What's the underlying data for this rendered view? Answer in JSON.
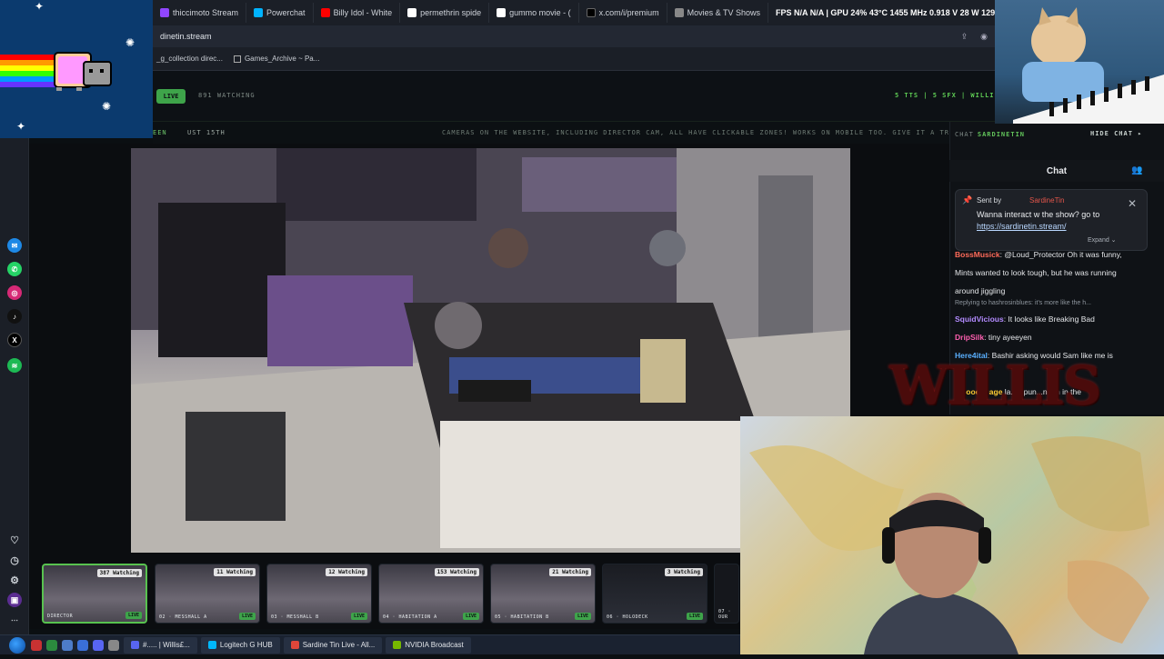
{
  "browser": {
    "tabs": [
      {
        "label": "thiccimoto Stream",
        "color": "#9146ff"
      },
      {
        "label": "Powerchat",
        "color": "#00b3ff"
      },
      {
        "label": "Billy Idol - White",
        "color": "#ff0000"
      },
      {
        "label": "permethrin spide",
        "color": "#ffffff"
      },
      {
        "label": "gummo movie - (",
        "color": "#ffffff"
      },
      {
        "label": "x.com/i/premium",
        "color": "#000000"
      },
      {
        "label": "Movies & TV Shows",
        "color": "#888888"
      },
      {
        "label": "FPS N/A N/A | GPU 24% 43°C 1455 MHz 0.918 V 28 W 1299 RPM",
        "color": "#1b1f27"
      }
    ],
    "address": "dinetin.stream",
    "bookmarks": [
      "_g_collection direc...",
      "Games_Archive ~ Pa..."
    ]
  },
  "site": {
    "live_label": "LIVE",
    "watching_label": "891 WATCHING",
    "tts_info": "5 TTS | 5 SFX | WILLISEXP",
    "ticker_left": "EEN",
    "ticker_date": "UST 15TH",
    "ticker_message": "CAMERAS ON THE WEBSITE, INCLUDING DIRECTOR CAM, ALL HAVE CLICKABLE ZONES! WORKS ON MOBILE TOO. GIVE IT A TRY!"
  },
  "thumbnails": [
    {
      "watching": "387 Watching",
      "label": "DIRECTOR",
      "live": "LIVE",
      "active": true
    },
    {
      "watching": "11 Watching",
      "label": "02 · MESSHALL A",
      "live": "LIVE",
      "active": false
    },
    {
      "watching": "12 Watching",
      "label": "03 · MESSHALL B",
      "live": "LIVE",
      "active": false
    },
    {
      "watching": "153 Watching",
      "label": "04 · HABITATION A",
      "live": "LIVE",
      "active": false
    },
    {
      "watching": "21 Watching",
      "label": "05 · HABITATION B",
      "live": "LIVE",
      "active": false
    },
    {
      "watching": "3 Watching",
      "label": "06 · HOLODECK",
      "live": "LIVE",
      "active": false
    },
    {
      "watching": "",
      "label": "07 · OUR",
      "live": "",
      "active": false
    }
  ],
  "chat": {
    "top_label": "CHAT",
    "top_channel": "SARDINETIN",
    "hide_label": "HIDE CHAT ▸",
    "header": "Chat",
    "pinned": {
      "sent_by": "Sent by",
      "sender": "SardineTin",
      "text": "Wanna interact w the show? go to",
      "link": "https://sardinetin.stream/",
      "expand": "Expand ⌄"
    },
    "messages": [
      {
        "user": "BossMusick",
        "color": "#ff6b5a",
        "text": "@Loud_Protector Oh it was funny,"
      },
      {
        "user": "",
        "color": "#e4e6e9",
        "text": "Mints wanted to look tough, but he was running"
      },
      {
        "user": "",
        "color": "#e4e6e9",
        "text": "around jiggling"
      },
      {
        "user": "SquidVicious",
        "color": "#b38bff",
        "text": "It looks like Breaking Bad"
      },
      {
        "user": "DripSilk",
        "color": "#ff5fb0",
        "text": "tiny ayeeyen"
      },
      {
        "user": "Here4ital",
        "color": "#5ab0ff",
        "text": "Bashir asking would Sam like me is"
      },
      {
        "user": "",
        "color": "#e4e6e9",
        "text": "g..."
      },
      {
        "user": "fl...ooengage",
        "color": "#ffcc33",
        "text": "la...e  pun...ndon in the"
      }
    ],
    "reply_text": "Replying to hashrosinblues: it's more like the h..."
  },
  "overlays": {
    "willis_logo": "WILLIS"
  },
  "taskbar": {
    "tasks": [
      {
        "label": "#..... | Willis£...",
        "color": "#5865f2"
      },
      {
        "label": "Logitech G HUB",
        "color": "#00b8fc"
      },
      {
        "label": "Sardine Tin Live - All...",
        "color": "#e0463a"
      },
      {
        "label": "NVIDIA Broadcast",
        "color": "#76b900"
      }
    ]
  }
}
